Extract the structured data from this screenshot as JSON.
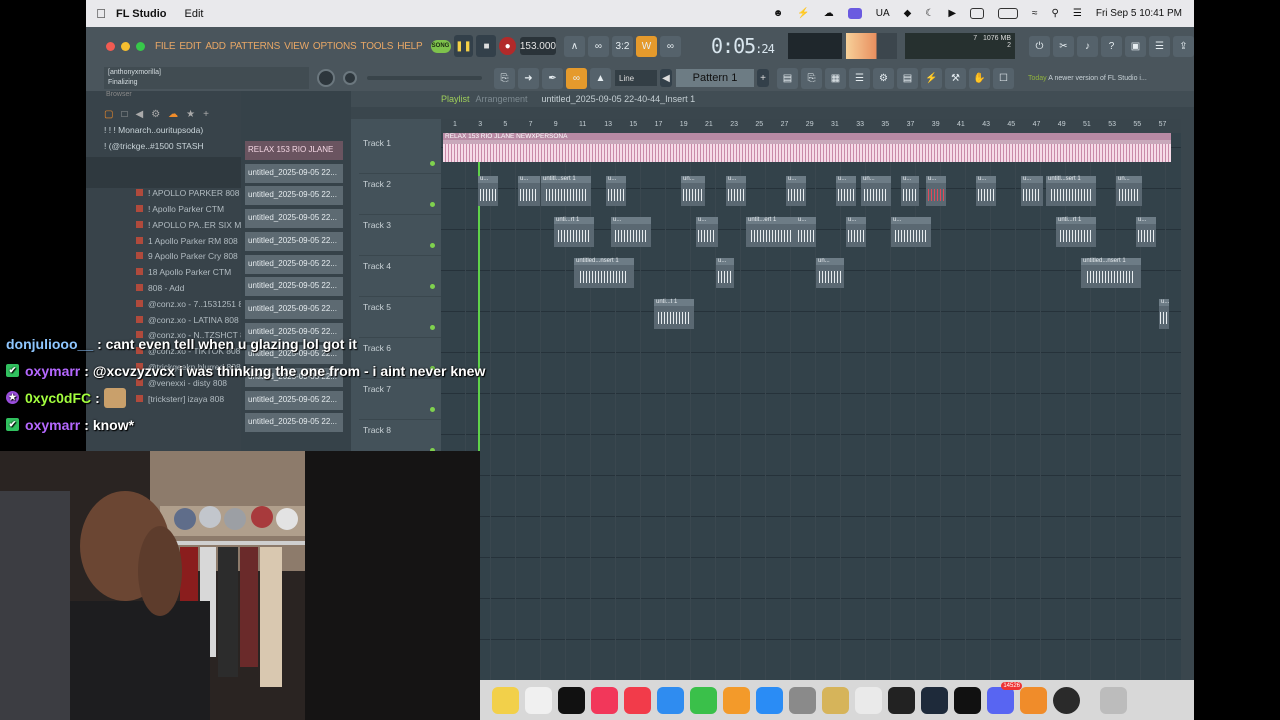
{
  "menubar": {
    "app": "FL Studio",
    "menu_edit": "Edit",
    "input_source": "UA",
    "datetime": "Fri Sep 5  10:41 PM"
  },
  "fl": {
    "menus": [
      "FILE",
      "EDIT",
      "ADD",
      "PATTERNS",
      "VIEW",
      "OPTIONS",
      "TOOLS",
      "HELP"
    ],
    "song_mode": "SONG",
    "tempo": "153.000",
    "time_main": "0:05",
    "time_sub": "24",
    "cpu": "7",
    "memory": "1076 MB",
    "polyphony": "2",
    "hint_top": "[anthonyxmorilla]",
    "hint_status": "Finalizing",
    "snap": "Line",
    "pattern": "Pattern 1",
    "news_label": "Today",
    "news_text": "A newer version of FL Studio i..."
  },
  "browser": {
    "title": "Browser",
    "items": [
      {
        "label": "! ! ! Monarch..ouritupsoda)",
        "type": "folder"
      },
      {
        "label": "! (@trickge..#1500 STASH",
        "type": "folder"
      },
      {
        "label": "",
        "type": "sel"
      },
      {
        "label": "",
        "type": "sel"
      },
      {
        "label": "! APOLLO PARKER 808 5",
        "type": "file"
      },
      {
        "label": "! Apollo Parker CTM",
        "type": "file"
      },
      {
        "label": "! APOLLO PA..ER SIX MESH",
        "type": "file"
      },
      {
        "label": "1 Apollo Parker RM 808",
        "type": "file"
      },
      {
        "label": "9 Apollo Parker Cry 808",
        "type": "file"
      },
      {
        "label": "18 Apollo Parker CTM",
        "type": "file"
      },
      {
        "label": "808 - Add",
        "type": "file"
      },
      {
        "label": "@conz.xo - 7..1531251 808",
        "type": "file"
      },
      {
        "label": "@conz.xo - LATINA 808",
        "type": "file"
      },
      {
        "label": "@conz.xo - N..TZSHCT 808",
        "type": "file"
      },
      {
        "label": "@conz.xo - TIKTOK 808",
        "type": "file"
      },
      {
        "label": "@trickgeekn blurred 808",
        "type": "file"
      },
      {
        "label": "@venexxi - disty 808",
        "type": "file"
      },
      {
        "label": "[tricksterr] izaya 808",
        "type": "file"
      }
    ]
  },
  "channels": [
    "RELAX 153 RIO JLANE",
    "untitled_2025-09-05 22...",
    "untitled_2025-09-05 22...",
    "untitled_2025-09-05 22...",
    "untitled_2025-09-05 22...",
    "untitled_2025-09-05 22...",
    "untitled_2025-09-05 22...",
    "untitled_2025-09-05 22...",
    "untitled_2025-09-05 22...",
    "untitled_2025-09-05 22...",
    "untitled_2025-09-05 22...",
    "untitled_2025-09-05 22...",
    "untitled_2025-09-05 22..."
  ],
  "playlist": {
    "title": "Playlist",
    "subtitle": "Arrangement",
    "project": "untitled_2025-09-05 22-40-44_Insert 1",
    "tracks": [
      "Track 1",
      "Track 2",
      "Track 3",
      "Track 4",
      "Track 5",
      "Track 6",
      "Track 7",
      "Track 8"
    ],
    "bars": [
      "1",
      "3",
      "5",
      "7",
      "9",
      "11",
      "13",
      "15",
      "17",
      "19",
      "21",
      "23",
      "25",
      "27",
      "29",
      "31",
      "33",
      "35",
      "37",
      "39",
      "41",
      "43",
      "45",
      "47",
      "49",
      "51",
      "53",
      "55",
      "57"
    ],
    "audio_clip": "RELAX 153 RIO JLANE NEWXPERSONA",
    "clip_names": {
      "short": "u...",
      "sert": "untitl...sert 1",
      "un": "un...",
      "rt": "unti...rt 1",
      "ert": "untit...ert 1",
      "nsert": "untitled...nsert 1",
      "t1": "unti...t 1",
      "insert": "untitled...nsert 1"
    }
  },
  "chat": [
    {
      "user": "donjuliooo__",
      "color": "#8fc7ff",
      "text": ": cant even tell when u glazing lol got it",
      "badge": "none"
    },
    {
      "user": "oxymarr",
      "color": "#b568ff",
      "text": ": @xcvzyzvcx i was thinking the one from - i aint never knew",
      "badge": "check"
    },
    {
      "user": "0xyc0dFC",
      "color": "#a3ff3e",
      "text": ":",
      "badge": "star"
    },
    {
      "user": "oxymarr",
      "color": "#b568ff",
      "text": ": know*",
      "badge": "check"
    }
  ],
  "dock_badge": "14526",
  "colors": {
    "accent_orange": "#e8a766",
    "accent_green": "#7ec24c",
    "audio_pink": "#c9a8bb"
  }
}
